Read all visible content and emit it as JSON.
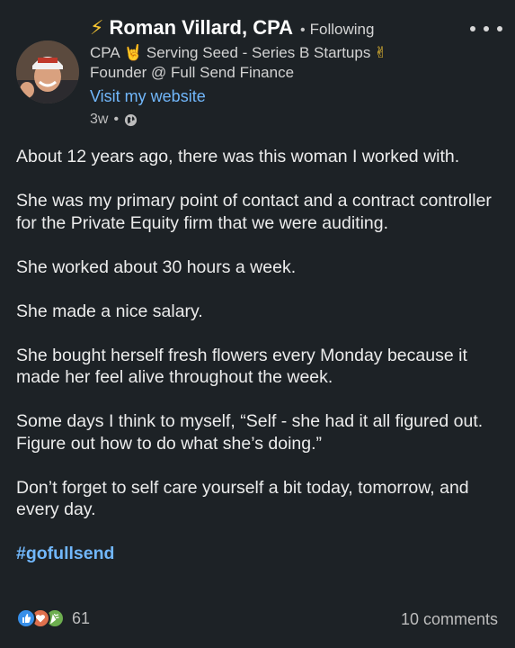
{
  "author": {
    "name": "Roman Villard, CPA",
    "name_prefix_icon": "lightning-bolt-emoji",
    "follow_status": "Following",
    "headline_line1_a": "CPA",
    "headline_line1_b": "Serving Seed - Series B Startups",
    "headline_line1_icons": [
      "rock-on-hand-emoji",
      "victory-hand-emoji"
    ],
    "headline_line2": "Founder @ Full Send Finance",
    "website_link": "Visit my website",
    "post_age": "3w",
    "visibility_icon": "globe-icon"
  },
  "post": {
    "paragraphs": [
      "About 12 years ago, there was this woman I worked with.",
      "She was my primary point of contact and a contract controller for the Private Equity firm that we were auditing.",
      "She worked about 30 hours a week.",
      "She made a nice salary.",
      "She bought herself fresh flowers every Monday because it made her feel alive throughout the week.",
      "Some days I think to myself, “Self - she had it all figured out. Figure out how to do what she’s doing.”",
      "Don’t forget to self care yourself a bit today, tomorrow, and every day."
    ],
    "hashtag": "#gofullsend"
  },
  "social": {
    "reaction_icons": [
      "like-icon",
      "love-icon",
      "celebrate-icon"
    ],
    "reaction_count": "61",
    "comments": "10 comments"
  },
  "colors": {
    "background": "#1d2226",
    "link": "#71b7fb",
    "like": "#378fe9",
    "love": "#df704d",
    "celebrate": "#6dae4f"
  }
}
